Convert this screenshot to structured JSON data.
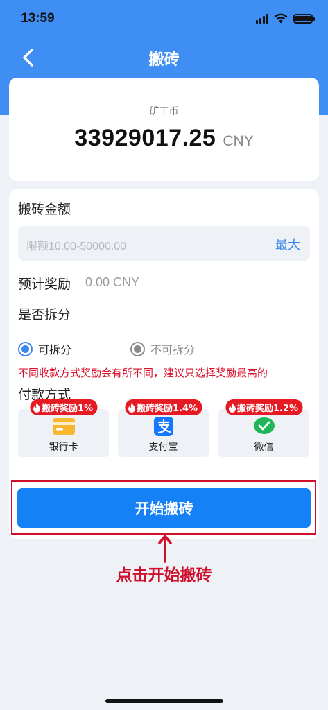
{
  "status_bar": {
    "time": "13:59"
  },
  "header": {
    "title": "搬砖"
  },
  "balance": {
    "label": "矿工币",
    "amount": "33929017.25",
    "currency": "CNY"
  },
  "form": {
    "amount_label": "搬砖金额",
    "amount_placeholder": "限额10.00-50000.00",
    "max_label": "最大",
    "reward_label": "预计奖励",
    "reward_value": "0.00 CNY",
    "split_label": "是否拆分",
    "split_options": [
      {
        "label": "可拆分",
        "selected": true
      },
      {
        "label": "不可拆分",
        "selected": false
      }
    ],
    "warning": "不同收款方式奖励会有所不同，建议只选择奖励最高的",
    "payment_label": "付款方式",
    "payment_methods": [
      {
        "name": "银行卡",
        "tag": "搬砖奖励1%",
        "icon": "bank-card-icon"
      },
      {
        "name": "支付宝",
        "tag": "搬砖奖励1.4%",
        "icon": "alipay-icon"
      },
      {
        "name": "微信",
        "tag": "搬砖奖励1.2%",
        "icon": "wechat-icon"
      }
    ]
  },
  "action": {
    "start_label": "开始搬砖"
  },
  "annotation": {
    "hint": "点击开始搬砖"
  },
  "colors": {
    "primary": "#1681f7",
    "header": "#3f8ef3",
    "alert": "#d0102a",
    "tag": "#e61a23"
  }
}
